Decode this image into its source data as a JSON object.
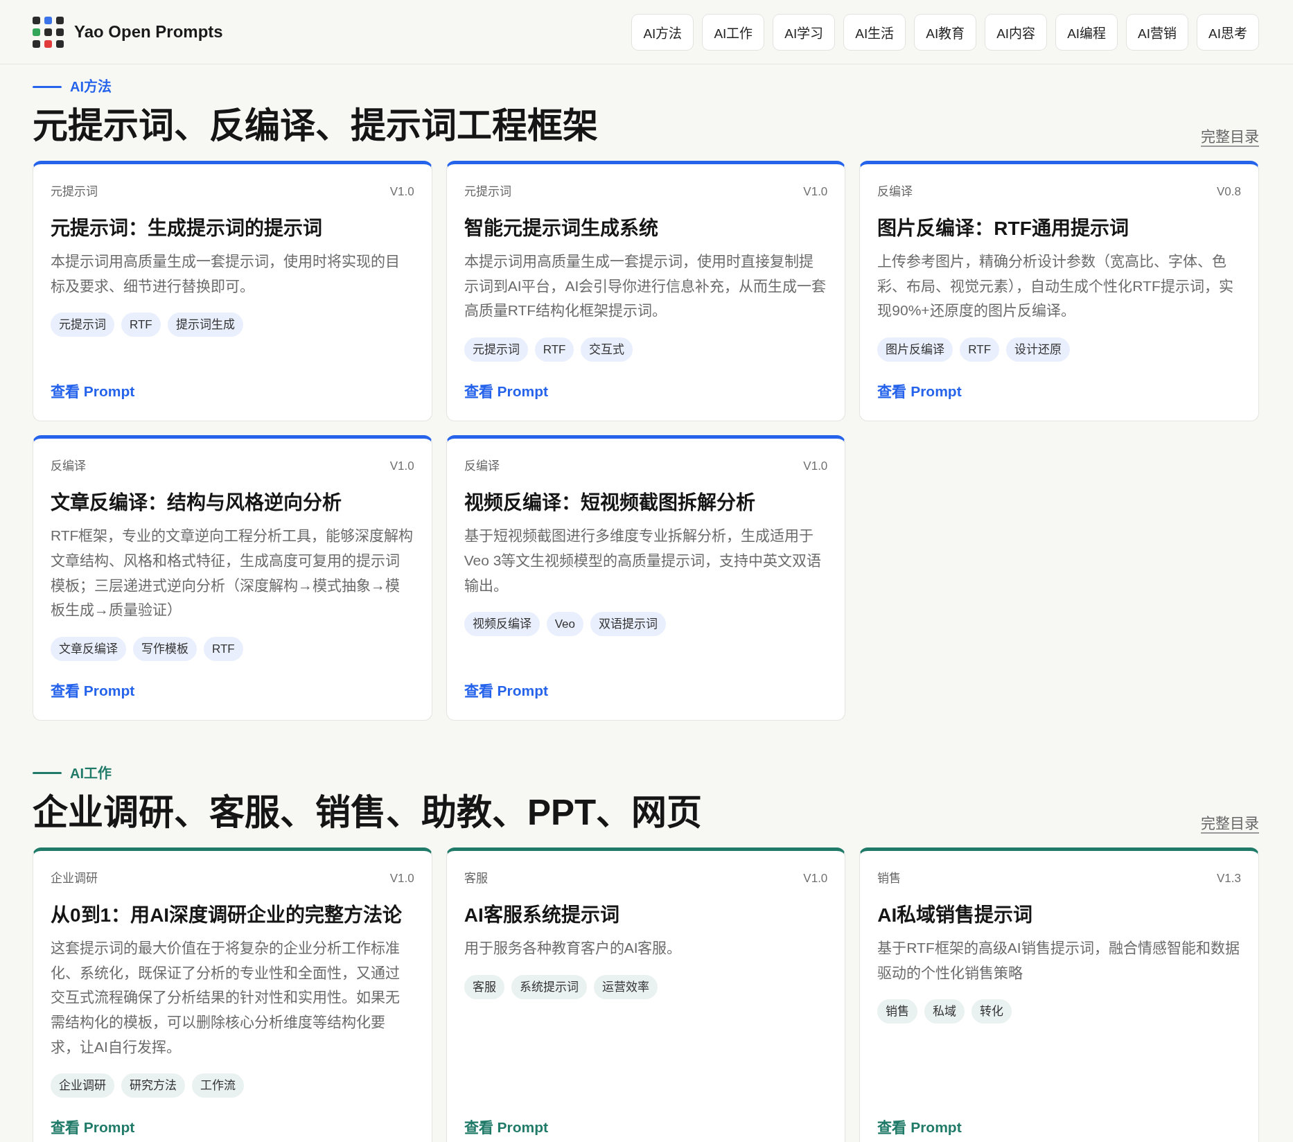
{
  "site": {
    "name": "Yao Open Prompts"
  },
  "nav": [
    {
      "label": "AI方法"
    },
    {
      "label": "AI工作"
    },
    {
      "label": "AI学习"
    },
    {
      "label": "AI生活"
    },
    {
      "label": "AI教育"
    },
    {
      "label": "AI内容"
    },
    {
      "label": "AI编程"
    },
    {
      "label": "AI营销"
    },
    {
      "label": "AI思考"
    }
  ],
  "sections": [
    {
      "eyebrow": "AI方法",
      "color": "#2563eb",
      "title": "元提示词、反编译、提示词工程框架",
      "catalog_link": "完整目录",
      "cards": [
        {
          "category": "元提示词",
          "version": "V1.0",
          "title": "元提示词：生成提示词的提示词",
          "description": "本提示词用高质量生成一套提示词，使用时将实现的目标及要求、细节进行替换即可。",
          "tags": [
            "元提示词",
            "RTF",
            "提示词生成"
          ],
          "link": "查看 Prompt"
        },
        {
          "category": "元提示词",
          "version": "V1.0",
          "title": "智能元提示词生成系统",
          "description": "本提示词用高质量生成一套提示词，使用时直接复制提示词到AI平台，AI会引导你进行信息补充，从而生成一套高质量RTF结构化框架提示词。",
          "tags": [
            "元提示词",
            "RTF",
            "交互式"
          ],
          "link": "查看 Prompt"
        },
        {
          "category": "反编译",
          "version": "V0.8",
          "title": "图片反编译：RTF通用提示词",
          "description": "上传参考图片，精确分析设计参数（宽高比、字体、色彩、布局、视觉元素），自动生成个性化RTF提示词，实现90%+还原度的图片反编译。",
          "tags": [
            "图片反编译",
            "RTF",
            "设计还原"
          ],
          "link": "查看 Prompt"
        },
        {
          "category": "反编译",
          "version": "V1.0",
          "title": "文章反编译：结构与风格逆向分析",
          "description": "RTF框架，专业的文章逆向工程分析工具，能够深度解构文章结构、风格和格式特征，生成高度可复用的提示词模板；三层递进式逆向分析（深度解构→模式抽象→模板生成→质量验证）",
          "tags": [
            "文章反编译",
            "写作模板",
            "RTF"
          ],
          "link": "查看 Prompt"
        },
        {
          "category": "反编译",
          "version": "V1.0",
          "title": "视频反编译：短视频截图拆解分析",
          "description": "基于短视频截图进行多维度专业拆解分析，生成适用于Veo 3等文生视频模型的高质量提示词，支持中英文双语输出。",
          "tags": [
            "视频反编译",
            "Veo",
            "双语提示词"
          ],
          "link": "查看 Prompt"
        }
      ]
    },
    {
      "eyebrow": "AI工作",
      "color": "#1f7a68",
      "title": "企业调研、客服、销售、助教、PPT、网页",
      "catalog_link": "完整目录",
      "cards": [
        {
          "category": "企业调研",
          "version": "V1.0",
          "title": "从0到1：用AI深度调研企业的完整方法论",
          "description": "这套提示词的最大价值在于将复杂的企业分析工作标准化、系统化，既保证了分析的专业性和全面性，又通过交互式流程确保了分析结果的针对性和实用性。如果无需结构化的模板，可以删除核心分析维度等结构化要求，让AI自行发挥。",
          "tags": [
            "企业调研",
            "研究方法",
            "工作流"
          ],
          "link": "查看 Prompt"
        },
        {
          "category": "客服",
          "version": "V1.0",
          "title": "AI客服系统提示词",
          "description": "用于服务各种教育客户的AI客服。",
          "tags": [
            "客服",
            "系统提示词",
            "运营效率"
          ],
          "link": "查看 Prompt"
        },
        {
          "category": "销售",
          "version": "V1.3",
          "title": "AI私域销售提示词",
          "description": "基于RTF框架的高级AI销售提示词，融合情感智能和数据驱动的个性化销售策略",
          "tags": [
            "销售",
            "私域",
            "转化"
          ],
          "link": "查看 Prompt"
        }
      ]
    }
  ]
}
